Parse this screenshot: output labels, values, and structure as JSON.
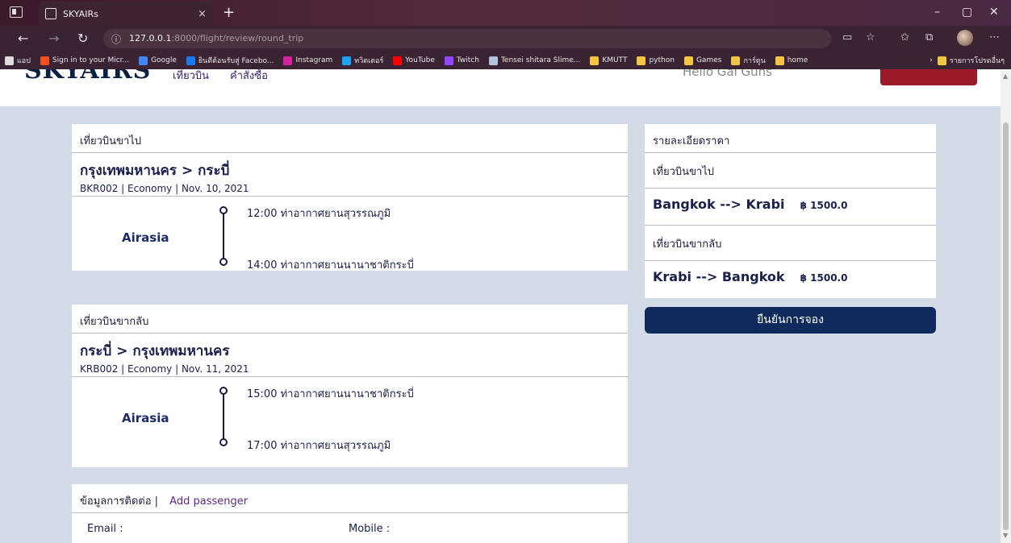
{
  "browser": {
    "tab_title": "SKYAIRs",
    "tab_close": "×",
    "new_tab": "+",
    "url_host": "127.0.0.1",
    "url_path": ":8000/flight/review/round_trip",
    "win_minimize": "–",
    "win_restore": "▢",
    "win_close": "✕",
    "bookmarks": [
      {
        "label": "แอป",
        "color": "#dddddd"
      },
      {
        "label": "Sign in to your Micr...",
        "color": "#f25022"
      },
      {
        "label": "Google",
        "color": "#4285f4"
      },
      {
        "label": "ยินดีต้อนรับสู่ Facebo...",
        "color": "#1877f2"
      },
      {
        "label": "Instagram",
        "color": "#d6249f"
      },
      {
        "label": "ทวิตเตอร์",
        "color": "#1da1f2"
      },
      {
        "label": "YouTube",
        "color": "#ff0000"
      },
      {
        "label": "Twitch",
        "color": "#9146ff"
      },
      {
        "label": "Tensei shitara Slime...",
        "color": "#b0c4de"
      },
      {
        "label": "KMUTT",
        "color": "#f4c542"
      },
      {
        "label": "python",
        "color": "#f4c542"
      },
      {
        "label": "Games",
        "color": "#f4c542"
      },
      {
        "label": "การ์ตูน",
        "color": "#f4c542"
      },
      {
        "label": "home",
        "color": "#f4c542"
      }
    ],
    "other_bookmarks": "รายการโปรดอื่นๆ"
  },
  "site": {
    "brand": "SKYAIRS",
    "nav": [
      "เที่ยวบิน",
      "คำสั่งซื้อ"
    ],
    "user": "Hello Gai Guns"
  },
  "outbound": {
    "header": "เที่ยวบินขาไป",
    "route": "กรุงเทพมหานคร > กระบี่",
    "sub": "BKR002 | Economy | Nov. 10, 2021",
    "airline": "Airasia",
    "depart": "12:00 ท่าอากาศยานสุวรรณภูมิ",
    "arrive": "14:00 ท่าอากาศยานนานาชาติกระบี่"
  },
  "inbound": {
    "header": "เที่ยวบินขากลับ",
    "route": "กระบี่ > กรุงเทพมหานคร",
    "sub": "KRB002 | Economy | Nov. 11, 2021",
    "airline": "Airasia",
    "depart": "15:00 ท่าอากาศยานนานาชาติกระบี่",
    "arrive": "17:00 ท่าอากาศยานสุวรรณภูมิ"
  },
  "contact": {
    "header": "ข้อมูลการติดต่อ |",
    "add_passenger": "Add passenger",
    "email_label": "Email :",
    "mobile_label": "Mobile :"
  },
  "price": {
    "header": "รายละเอียดราคา",
    "out_label": "เที่ยวบินขาไป",
    "out_route": "Bangkok --> Krabi",
    "out_price": "฿ 1500.0",
    "in_label": "เที่ยวบินขากลับ",
    "in_route": "Krabi --> Bangkok",
    "in_price": "฿ 1500.0",
    "confirm": "ยืนยันการจอง"
  }
}
